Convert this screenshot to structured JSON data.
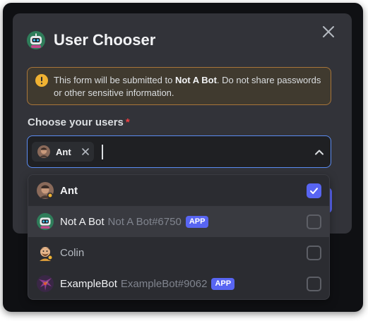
{
  "dialog": {
    "title": "User Chooser",
    "title_avatar": "robot-avatar"
  },
  "warning": {
    "icon": "alert-circle-icon",
    "text_before": "This form will be submitted to ",
    "app_name": "Not A Bot",
    "text_after": ". Do not share passwords or other sensitive information."
  },
  "field": {
    "label": "Choose your users",
    "required_marker": "*"
  },
  "selected": [
    {
      "label": "Ant",
      "avatar": "ant-avatar"
    }
  ],
  "options": [
    {
      "name": "Ant",
      "tag": "",
      "badge": "",
      "checked": true,
      "avatar": "ant-avatar"
    },
    {
      "name": "Not A Bot",
      "tag": "Not A Bot#6750",
      "badge": "APP",
      "checked": false,
      "avatar": "robot-avatar"
    },
    {
      "name": "Colin",
      "tag": "",
      "badge": "",
      "checked": false,
      "avatar": "colin-avatar"
    },
    {
      "name": "ExampleBot",
      "tag": "ExampleBot#9062",
      "badge": "APP",
      "checked": false,
      "avatar": "examplebot-avatar"
    }
  ],
  "colors": {
    "accent": "#5865f2",
    "focus_border": "#5b8cf2",
    "warning_border": "#a8763a",
    "required": "#f23f43"
  }
}
